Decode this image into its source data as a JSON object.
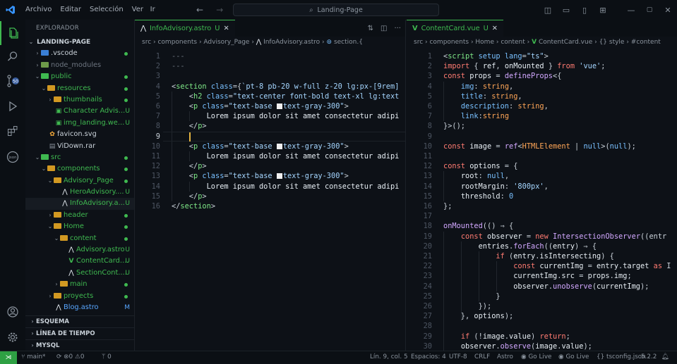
{
  "titlebar": {
    "menu": [
      "Archivo",
      "Editar",
      "Selección",
      "Ver",
      "Ir"
    ],
    "search": "Landing-Page"
  },
  "sidebar": {
    "title": "EXPLORADOR",
    "root": "LANDING-PAGE",
    "items": [
      {
        "label": ".vscode",
        "type": "folder",
        "depth": 1,
        "open": false,
        "color": "#c9d1d9",
        "mark": "dot"
      },
      {
        "label": "node_modules",
        "type": "folder",
        "depth": 1,
        "open": false,
        "color": "#6e7681",
        "mark": ""
      },
      {
        "label": "public",
        "type": "folder-green",
        "depth": 1,
        "open": true,
        "color": "#3fb950",
        "mark": "dot"
      },
      {
        "label": "resources",
        "type": "folder",
        "depth": 2,
        "open": true,
        "color": "#3fb950",
        "mark": "dot"
      },
      {
        "label": "thumbnails",
        "type": "folder",
        "depth": 3,
        "open": false,
        "color": "#3fb950",
        "mark": "dot"
      },
      {
        "label": "Character Advis...",
        "type": "img",
        "depth": 3,
        "color": "#3fb950",
        "mark": "U"
      },
      {
        "label": "img_landing.we...",
        "type": "img",
        "depth": 3,
        "color": "#3fb950",
        "mark": "U"
      },
      {
        "label": "favicon.svg",
        "type": "svg",
        "depth": 2,
        "color": "#c9d1d9",
        "mark": ""
      },
      {
        "label": "ViDown.rar",
        "type": "file",
        "depth": 2,
        "color": "#c9d1d9",
        "mark": ""
      },
      {
        "label": "src",
        "type": "folder-green",
        "depth": 1,
        "open": true,
        "color": "#3fb950",
        "mark": "dot"
      },
      {
        "label": "components",
        "type": "folder",
        "depth": 2,
        "open": true,
        "color": "#3fb950",
        "mark": "dot"
      },
      {
        "label": "Advisory_Page",
        "type": "folder",
        "depth": 3,
        "open": true,
        "color": "#3fb950",
        "mark": "dot"
      },
      {
        "label": "HeroAdvisory....",
        "type": "astro",
        "depth": 4,
        "color": "#3fb950",
        "mark": "U"
      },
      {
        "label": "InfoAdvisory.a...",
        "type": "astro",
        "depth": 4,
        "color": "#3fb950",
        "mark": "U",
        "selected": true
      },
      {
        "label": "header",
        "type": "folder",
        "depth": 3,
        "open": false,
        "color": "#3fb950",
        "mark": "dot"
      },
      {
        "label": "Home",
        "type": "folder",
        "depth": 3,
        "open": true,
        "color": "#3fb950",
        "mark": "dot"
      },
      {
        "label": "content",
        "type": "folder",
        "depth": 4,
        "open": true,
        "color": "#3fb950",
        "mark": "dot"
      },
      {
        "label": "Advisory.astro",
        "type": "astro",
        "depth": 5,
        "color": "#3fb950",
        "mark": "U"
      },
      {
        "label": "ContentCard....",
        "type": "vue",
        "depth": 5,
        "color": "#3fb950",
        "mark": "U"
      },
      {
        "label": "SectionCont....",
        "type": "astro",
        "depth": 5,
        "color": "#3fb950",
        "mark": "U"
      },
      {
        "label": "main",
        "type": "folder",
        "depth": 4,
        "open": false,
        "color": "#3fb950",
        "mark": "dot"
      },
      {
        "label": "proyects",
        "type": "folder",
        "depth": 3,
        "open": false,
        "color": "#3fb950",
        "mark": "dot"
      },
      {
        "label": "Blog.astro",
        "type": "astro",
        "depth": 3,
        "color": "#58a6ff",
        "mark": "M"
      }
    ],
    "sections": [
      "ESQUEMA",
      "LÍNEA DE TIEMPO",
      "MYSQL"
    ]
  },
  "editor_left": {
    "tab": "InfoAdvisory.astro",
    "tab_status": "U",
    "crumbs": [
      "src",
      "components",
      "Advisory_Page",
      "InfoAdvisory.astro",
      "section.{"
    ],
    "lines": [
      [
        [
          "t-dim",
          "---"
        ]
      ],
      [
        [
          "t-dim",
          "---"
        ]
      ],
      [],
      [
        [
          "t-punc",
          "<"
        ],
        [
          "t-tag",
          "section"
        ],
        [
          "t-punc",
          " "
        ],
        [
          "t-attr",
          "class"
        ],
        [
          "t-punc",
          "={"
        ],
        [
          "t-str",
          "`pt-8 pb-20 w-full z-20 lg:px-[9rem]"
        ]
      ],
      [
        [
          "t-punc",
          "    <"
        ],
        [
          "t-tag",
          "h2"
        ],
        [
          "t-punc",
          " "
        ],
        [
          "t-attr",
          "class"
        ],
        [
          "t-punc",
          "="
        ],
        [
          "t-str",
          "\"text-center font-bold text-xl lg:text"
        ]
      ],
      [
        [
          "t-punc",
          "    <"
        ],
        [
          "t-tag",
          "p"
        ],
        [
          "t-punc",
          " "
        ],
        [
          "t-attr",
          "class"
        ],
        [
          "t-punc",
          "="
        ],
        [
          "t-str",
          "\"text-base "
        ],
        [
          "swatch",
          ""
        ],
        [
          "t-str",
          "text-gray-300\""
        ],
        [
          "t-punc",
          ">"
        ]
      ],
      [
        [
          "t-txt",
          "        Lorem ipsum dolor sit amet consectetur adipi"
        ]
      ],
      [
        [
          "t-punc",
          "    </"
        ],
        [
          "t-tag",
          "p"
        ],
        [
          "t-punc",
          ">"
        ]
      ],
      [],
      [
        [
          "t-punc",
          "    <"
        ],
        [
          "t-tag",
          "p"
        ],
        [
          "t-punc",
          " "
        ],
        [
          "t-attr",
          "class"
        ],
        [
          "t-punc",
          "="
        ],
        [
          "t-str",
          "\"text-base "
        ],
        [
          "swatch",
          ""
        ],
        [
          "t-str",
          "text-gray-300\""
        ],
        [
          "t-punc",
          ">"
        ]
      ],
      [
        [
          "t-txt",
          "        Lorem ipsum dolor sit amet consectetur adipi"
        ]
      ],
      [
        [
          "t-punc",
          "    </"
        ],
        [
          "t-tag",
          "p"
        ],
        [
          "t-punc",
          ">"
        ]
      ],
      [
        [
          "t-punc",
          "    <"
        ],
        [
          "t-tag",
          "p"
        ],
        [
          "t-punc",
          " "
        ],
        [
          "t-attr",
          "class"
        ],
        [
          "t-punc",
          "="
        ],
        [
          "t-str",
          "\"text-base "
        ],
        [
          "swatch",
          ""
        ],
        [
          "t-str",
          "text-gray-300\""
        ],
        [
          "t-punc",
          ">"
        ]
      ],
      [
        [
          "t-txt",
          "        Lorem ipsum dolor sit amet consectetur adipi"
        ]
      ],
      [
        [
          "t-punc",
          "    </"
        ],
        [
          "t-tag",
          "p"
        ],
        [
          "t-punc",
          ">"
        ]
      ],
      [
        [
          "t-punc",
          "</"
        ],
        [
          "t-tag",
          "section"
        ],
        [
          "t-punc",
          ">"
        ]
      ]
    ]
  },
  "editor_right": {
    "tab": "ContentCard.vue",
    "tab_status": "U",
    "crumbs": [
      "src",
      "components",
      "Home",
      "content",
      "ContentCard.vue",
      "{} style",
      "#content"
    ],
    "lines": [
      [
        [
          "t-punc",
          "<"
        ],
        [
          "t-tag",
          "script"
        ],
        [
          "t-punc",
          " "
        ],
        [
          "t-attr",
          "setup"
        ],
        [
          "t-punc",
          " "
        ],
        [
          "t-attr",
          "lang"
        ],
        [
          "t-punc",
          "="
        ],
        [
          "t-str",
          "\"ts\""
        ],
        [
          "t-punc",
          ">"
        ]
      ],
      [
        [
          "t-kw",
          "import"
        ],
        [
          "t-punc",
          " { "
        ],
        [
          "t-txt",
          "ref"
        ],
        [
          "t-punc",
          ", "
        ],
        [
          "t-txt",
          "onMounted"
        ],
        [
          "t-punc",
          " } "
        ],
        [
          "t-kw",
          "from"
        ],
        [
          "t-punc",
          " "
        ],
        [
          "t-str",
          "'vue'"
        ],
        [
          "t-punc",
          ";"
        ]
      ],
      [
        [
          "t-kw",
          "const"
        ],
        [
          "t-punc",
          " "
        ],
        [
          "t-txt",
          "props"
        ],
        [
          "t-punc",
          " = "
        ],
        [
          "t-fn",
          "defineProps"
        ],
        [
          "t-punc",
          "<{"
        ]
      ],
      [
        [
          "t-punc",
          "    "
        ],
        [
          "t-attr",
          "img"
        ],
        [
          "t-punc",
          ": "
        ],
        [
          "t-type",
          "string"
        ],
        [
          "t-punc",
          ","
        ]
      ],
      [
        [
          "t-punc",
          "    "
        ],
        [
          "t-attr",
          "title"
        ],
        [
          "t-punc",
          ": "
        ],
        [
          "t-type",
          "string"
        ],
        [
          "t-punc",
          ","
        ]
      ],
      [
        [
          "t-punc",
          "    "
        ],
        [
          "t-attr",
          "description"
        ],
        [
          "t-punc",
          ": "
        ],
        [
          "t-type",
          "string"
        ],
        [
          "t-punc",
          ","
        ]
      ],
      [
        [
          "t-punc",
          "    "
        ],
        [
          "t-attr",
          "link"
        ],
        [
          "t-punc",
          ":"
        ],
        [
          "t-type",
          "string"
        ]
      ],
      [
        [
          "t-punc",
          "}>();"
        ]
      ],
      [],
      [
        [
          "t-kw",
          "const"
        ],
        [
          "t-punc",
          " "
        ],
        [
          "t-txt",
          "image"
        ],
        [
          "t-punc",
          " = "
        ],
        [
          "t-fn",
          "ref"
        ],
        [
          "t-punc",
          "<"
        ],
        [
          "t-type",
          "HTMLElement"
        ],
        [
          "t-punc",
          " | "
        ],
        [
          "t-num",
          "null"
        ],
        [
          "t-punc",
          ">("
        ],
        [
          "t-num",
          "null"
        ],
        [
          "t-punc",
          ");"
        ]
      ],
      [],
      [
        [
          "t-kw",
          "const"
        ],
        [
          "t-punc",
          " "
        ],
        [
          "t-txt",
          "options"
        ],
        [
          "t-punc",
          " = {"
        ]
      ],
      [
        [
          "t-punc",
          "    "
        ],
        [
          "t-txt",
          "root"
        ],
        [
          "t-punc",
          ": "
        ],
        [
          "t-num",
          "null"
        ],
        [
          "t-punc",
          ","
        ]
      ],
      [
        [
          "t-punc",
          "    "
        ],
        [
          "t-txt",
          "rootMargin"
        ],
        [
          "t-punc",
          ": "
        ],
        [
          "t-str",
          "'800px'"
        ],
        [
          "t-punc",
          ","
        ]
      ],
      [
        [
          "t-punc",
          "    "
        ],
        [
          "t-txt",
          "threshold"
        ],
        [
          "t-punc",
          ": "
        ],
        [
          "t-num",
          "0"
        ]
      ],
      [
        [
          "t-punc",
          "};"
        ]
      ],
      [],
      [
        [
          "t-fn",
          "onMounted"
        ],
        [
          "t-punc",
          "(() ⇒ {"
        ]
      ],
      [
        [
          "t-punc",
          "    "
        ],
        [
          "t-kw",
          "const"
        ],
        [
          "t-punc",
          " "
        ],
        [
          "t-txt",
          "observer"
        ],
        [
          "t-punc",
          " = "
        ],
        [
          "t-kw",
          "new"
        ],
        [
          "t-punc",
          " "
        ],
        [
          "t-fn",
          "IntersectionObserver"
        ],
        [
          "t-punc",
          "((entr"
        ]
      ],
      [
        [
          "t-punc",
          "        "
        ],
        [
          "t-txt",
          "entries"
        ],
        [
          "t-punc",
          "."
        ],
        [
          "t-fn",
          "forEach"
        ],
        [
          "t-punc",
          "(("
        ],
        [
          "t-txt",
          "entry"
        ],
        [
          "t-punc",
          ") ⇒ {"
        ]
      ],
      [
        [
          "t-punc",
          "            "
        ],
        [
          "t-kw",
          "if"
        ],
        [
          "t-punc",
          " ("
        ],
        [
          "t-txt",
          "entry"
        ],
        [
          "t-punc",
          "."
        ],
        [
          "t-txt",
          "isIntersecting"
        ],
        [
          "t-punc",
          ") {"
        ]
      ],
      [
        [
          "t-punc",
          "                "
        ],
        [
          "t-kw",
          "const"
        ],
        [
          "t-punc",
          " "
        ],
        [
          "t-txt",
          "currentImg"
        ],
        [
          "t-punc",
          " = "
        ],
        [
          "t-txt",
          "entry"
        ],
        [
          "t-punc",
          "."
        ],
        [
          "t-txt",
          "target"
        ],
        [
          "t-punc",
          " "
        ],
        [
          "t-kw",
          "as"
        ],
        [
          "t-punc",
          " I"
        ]
      ],
      [
        [
          "t-punc",
          "                "
        ],
        [
          "t-txt",
          "currentImg"
        ],
        [
          "t-punc",
          "."
        ],
        [
          "t-txt",
          "src"
        ],
        [
          "t-punc",
          " = "
        ],
        [
          "t-txt",
          "props"
        ],
        [
          "t-punc",
          "."
        ],
        [
          "t-txt",
          "img"
        ],
        [
          "t-punc",
          ";"
        ]
      ],
      [
        [
          "t-punc",
          "                "
        ],
        [
          "t-txt",
          "observer"
        ],
        [
          "t-punc",
          "."
        ],
        [
          "t-fn",
          "unobserve"
        ],
        [
          "t-punc",
          "("
        ],
        [
          "t-txt",
          "currentImg"
        ],
        [
          "t-punc",
          ");"
        ]
      ],
      [
        [
          "t-punc",
          "            }"
        ]
      ],
      [
        [
          "t-punc",
          "        });"
        ]
      ],
      [
        [
          "t-punc",
          "    }, "
        ],
        [
          "t-txt",
          "options"
        ],
        [
          "t-punc",
          ");"
        ]
      ],
      [],
      [
        [
          "t-punc",
          "    "
        ],
        [
          "t-kw",
          "if"
        ],
        [
          "t-punc",
          " (!"
        ],
        [
          "t-txt",
          "image"
        ],
        [
          "t-punc",
          "."
        ],
        [
          "t-txt",
          "value"
        ],
        [
          "t-punc",
          ") "
        ],
        [
          "t-kw",
          "return"
        ],
        [
          "t-punc",
          ";"
        ]
      ],
      [
        [
          "t-punc",
          "    "
        ],
        [
          "t-txt",
          "observer"
        ],
        [
          "t-punc",
          "."
        ],
        [
          "t-fn",
          "observe"
        ],
        [
          "t-punc",
          "("
        ],
        [
          "t-txt",
          "image"
        ],
        [
          "t-punc",
          "."
        ],
        [
          "t-txt",
          "value"
        ],
        [
          "t-punc",
          ");"
        ]
      ]
    ]
  },
  "status": {
    "branch": "main*",
    "errors": "0",
    "warnings": "0",
    "ports": "0",
    "position": "Lín. 9, col. 5",
    "spaces": "Espacios: 4",
    "encoding": "UTF-8",
    "eol": "CRLF",
    "language": "Astro",
    "golive1": "Go Live",
    "golive2": "Go Live",
    "tsconfig": "tsconfig.json",
    "version": "5.2.2"
  },
  "colors": {
    "accent": "#3fb950",
    "background": "#0d1117"
  }
}
